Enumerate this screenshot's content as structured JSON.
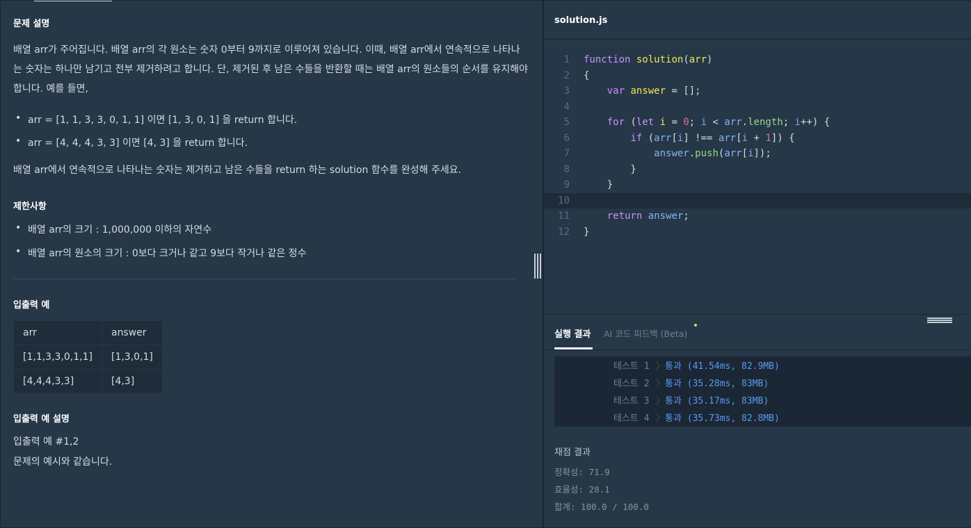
{
  "problem": {
    "title": "문제 설명",
    "desc1": "배열 arr가 주어집니다. 배열 arr의 각 원소는 숫자 0부터 9까지로 이루어져 있습니다. 이때, 배열 arr에서 연속적으로 나타나는 숫자는 하나만 남기고 전부 제거하려고 합니다. 단, 제거된 후 남은 수들을 반환할 때는 배열 arr의 원소들의 순서를 유지해야 합니다. 예를 들면,",
    "examples": [
      "arr = [1, 1, 3, 3, 0, 1, 1] 이면 [1, 3, 0, 1] 을 return 합니다.",
      "arr = [4, 4, 4, 3, 3] 이면 [4, 3] 을 return 합니다."
    ],
    "desc2": "배열 arr에서 연속적으로 나타나는 숫자는 제거하고 남은 수들을 return 하는 solution 함수를 완성해 주세요.",
    "constraints_title": "제한사항",
    "constraints": [
      "배열 arr의 크기 : 1,000,000 이하의 자연수",
      "배열 arr의 원소의 크기 : 0보다 크거나 같고 9보다 작거나 같은 정수"
    ],
    "io_title": "입출력 예",
    "io_table": {
      "headers": [
        "arr",
        "answer"
      ],
      "rows": [
        [
          "[1,1,3,3,0,1,1]",
          "[1,3,0,1]"
        ],
        [
          "[4,4,4,3,3]",
          "[4,3]"
        ]
      ]
    },
    "io_desc_title": "입출력 예 설명",
    "io_desc_lines": [
      "입출력 예 #1,2",
      "문제의 예시와 같습니다."
    ]
  },
  "editor": {
    "filename": "solution.js",
    "line_numbers": [
      "1",
      "2",
      "3",
      "4",
      "5",
      "6",
      "7",
      "8",
      "9",
      "10",
      "11",
      "12"
    ],
    "active_line": 10
  },
  "results_panel": {
    "tab_run": "실행 결과",
    "tab_ai": "AI 코드 피드백 (Beta)",
    "tests": [
      {
        "label": "테스트 1",
        "sep": "〉",
        "result": "통과 (41.54ms, 82.9MB)"
      },
      {
        "label": "테스트 2",
        "sep": "〉",
        "result": "통과 (35.28ms, 83MB)"
      },
      {
        "label": "테스트 3",
        "sep": "〉",
        "result": "통과 (35.17ms, 83MB)"
      },
      {
        "label": "테스트 4",
        "sep": "〉",
        "result": "통과 (35.73ms, 82.8MB)"
      }
    ],
    "score_title": "채점 결과",
    "accuracy": "정확성: 71.9",
    "efficiency": "효율성: 28.1",
    "total": "합계: 100.0 / 100.0"
  },
  "colors": {
    "background": "#263747",
    "keyword": "#c791ff",
    "function_name": "#f2e45a",
    "variable": "#85b4f5",
    "pass": "#5c98f0"
  }
}
